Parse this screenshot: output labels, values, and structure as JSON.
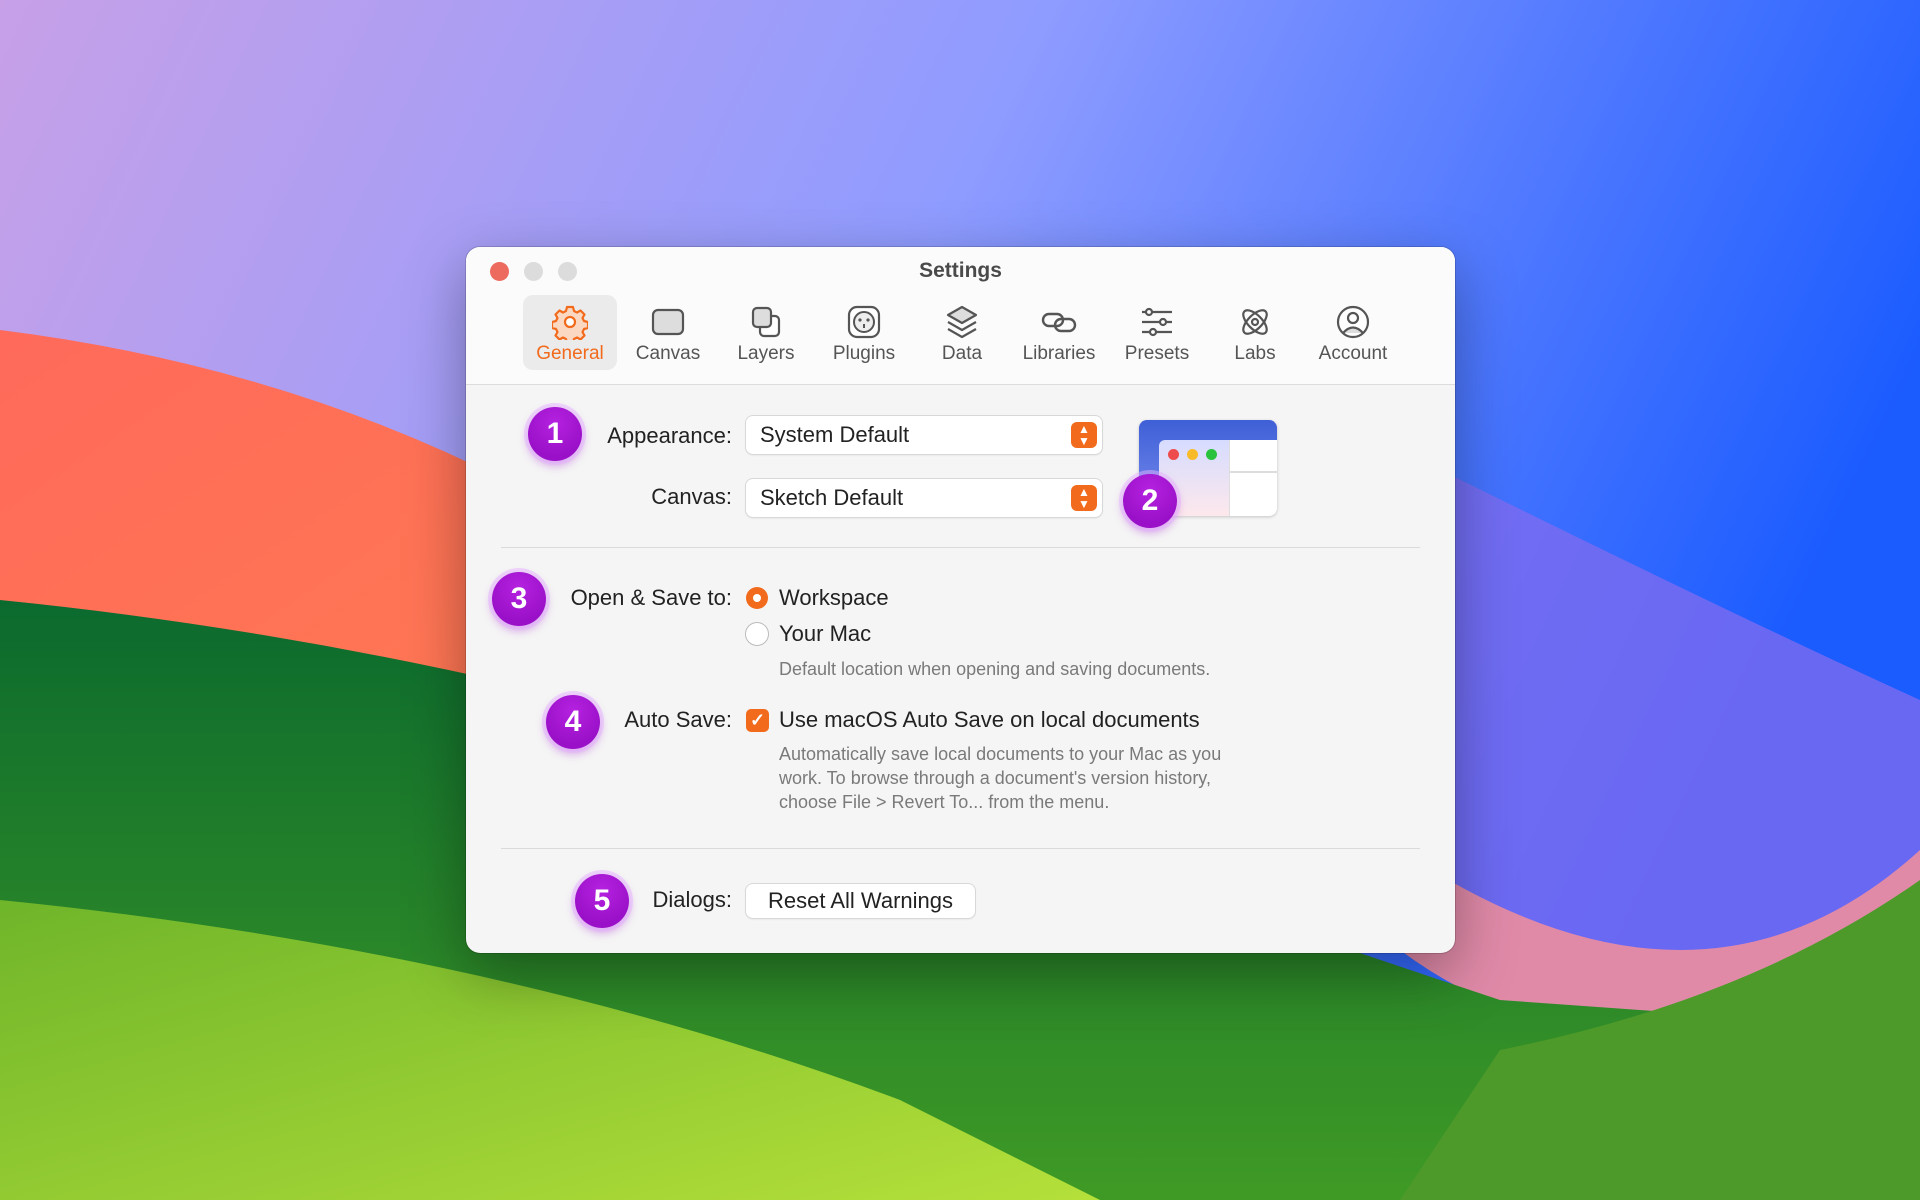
{
  "window": {
    "title": "Settings"
  },
  "tabs": [
    {
      "label": "General",
      "icon": "gear-icon",
      "active": true
    },
    {
      "label": "Canvas",
      "icon": "canvas-icon"
    },
    {
      "label": "Layers",
      "icon": "layers-icon"
    },
    {
      "label": "Plugins",
      "icon": "plugins-icon"
    },
    {
      "label": "Data",
      "icon": "data-stack-icon"
    },
    {
      "label": "Libraries",
      "icon": "link-icon"
    },
    {
      "label": "Presets",
      "icon": "sliders-icon"
    },
    {
      "label": "Labs",
      "icon": "atom-icon"
    },
    {
      "label": "Account",
      "icon": "user-circle-icon"
    }
  ],
  "badges": [
    "1",
    "2",
    "3",
    "4",
    "5"
  ],
  "appearance": {
    "label": "Appearance:",
    "value": "System Default"
  },
  "canvas": {
    "label": "Canvas:",
    "value": "Sketch Default"
  },
  "open_save": {
    "label": "Open & Save to:",
    "options": [
      "Workspace",
      "Your Mac"
    ],
    "selected": "Workspace",
    "help": "Default location when opening and saving documents."
  },
  "auto_save": {
    "label": "Auto Save:",
    "checkbox_label": "Use macOS Auto Save on local documents",
    "checked": true,
    "help": [
      "Automatically save local documents to your Mac as you",
      "work. To browse through a document's version history,",
      "choose File > Revert To... from the menu."
    ]
  },
  "dialogs": {
    "label": "Dialogs:",
    "button": "Reset All Warnings"
  },
  "colors": {
    "accent": "#f26a1b",
    "badge": "#a516d6"
  }
}
